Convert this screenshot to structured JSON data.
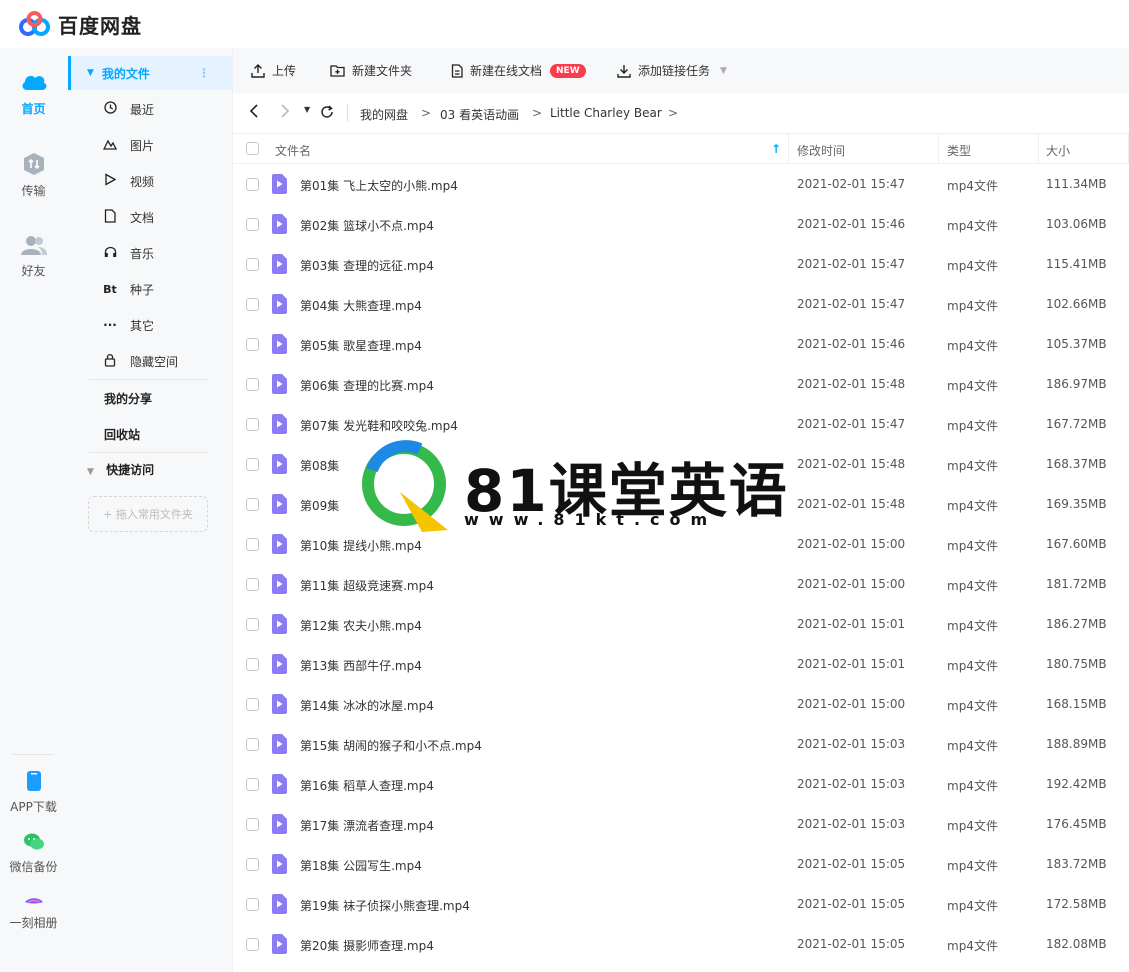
{
  "app": {
    "title": "百度网盘"
  },
  "rail": {
    "items": [
      {
        "label": "首页",
        "icon": "cloud-icon",
        "active": true
      },
      {
        "label": "传输",
        "icon": "transfer-icon"
      },
      {
        "label": "好友",
        "icon": "friends-icon"
      }
    ],
    "bottom": [
      {
        "label": "APP下载",
        "icon": "phone-icon"
      },
      {
        "label": "微信备份",
        "icon": "wechat-icon"
      },
      {
        "label": "一刻相册",
        "icon": "album-icon"
      }
    ]
  },
  "sidebar": {
    "header": "我的文件",
    "items": [
      {
        "label": "最近",
        "icon": "clock-icon"
      },
      {
        "label": "图片",
        "icon": "image-icon"
      },
      {
        "label": "视频",
        "icon": "video-icon"
      },
      {
        "label": "文档",
        "icon": "document-icon"
      },
      {
        "label": "音乐",
        "icon": "headphones-icon"
      },
      {
        "label": "种子",
        "icon": "bt-icon",
        "glyph": "Bt"
      },
      {
        "label": "其它",
        "icon": "more-icon"
      },
      {
        "label": "隐藏空间",
        "icon": "lock-icon"
      }
    ],
    "share": "我的分享",
    "recycle": "回收站",
    "quick_access": "快捷访问",
    "drop_hint": "+ 拖入常用文件夹"
  },
  "toolbar": {
    "upload": "上传",
    "new_folder": "新建文件夹",
    "new_doc": "新建在线文档",
    "new_badge": "NEW",
    "add_link": "添加链接任务"
  },
  "breadcrumb": {
    "segments": [
      "我的网盘",
      "03 看英语动画",
      "Little Charley Bear"
    ],
    "separator": ">"
  },
  "table": {
    "headers": {
      "name": "文件名",
      "modified": "修改时间",
      "type": "类型",
      "size": "大小"
    },
    "rows": [
      {
        "name": "第01集 飞上太空的小熊.mp4",
        "modified": "2021-02-01 15:47",
        "type": "mp4文件",
        "size": "111.34MB"
      },
      {
        "name": "第02集 篮球小不点.mp4",
        "modified": "2021-02-01 15:46",
        "type": "mp4文件",
        "size": "103.06MB"
      },
      {
        "name": "第03集 查理的远征.mp4",
        "modified": "2021-02-01 15:47",
        "type": "mp4文件",
        "size": "115.41MB"
      },
      {
        "name": "第04集 大熊查理.mp4",
        "modified": "2021-02-01 15:47",
        "type": "mp4文件",
        "size": "102.66MB"
      },
      {
        "name": "第05集 歌星查理.mp4",
        "modified": "2021-02-01 15:46",
        "type": "mp4文件",
        "size": "105.37MB"
      },
      {
        "name": "第06集 查理的比赛.mp4",
        "modified": "2021-02-01 15:48",
        "type": "mp4文件",
        "size": "186.97MB"
      },
      {
        "name": "第07集 发光鞋和咬咬兔.mp4",
        "modified": "2021-02-01 15:47",
        "type": "mp4文件",
        "size": "167.72MB"
      },
      {
        "name": "第08集",
        "modified": "2021-02-01 15:48",
        "type": "mp4文件",
        "size": "168.37MB"
      },
      {
        "name": "第09集",
        "modified": "2021-02-01 15:48",
        "type": "mp4文件",
        "size": "169.35MB"
      },
      {
        "name": "第10集 提线小熊.mp4",
        "modified": "2021-02-01 15:00",
        "type": "mp4文件",
        "size": "167.60MB"
      },
      {
        "name": "第11集 超级竞速赛.mp4",
        "modified": "2021-02-01 15:00",
        "type": "mp4文件",
        "size": "181.72MB"
      },
      {
        "name": "第12集 农夫小熊.mp4",
        "modified": "2021-02-01 15:01",
        "type": "mp4文件",
        "size": "186.27MB"
      },
      {
        "name": "第13集 西部牛仔.mp4",
        "modified": "2021-02-01 15:01",
        "type": "mp4文件",
        "size": "180.75MB"
      },
      {
        "name": "第14集 冰冰的冰屋.mp4",
        "modified": "2021-02-01 15:00",
        "type": "mp4文件",
        "size": "168.15MB"
      },
      {
        "name": "第15集 胡闹的猴子和小不点.mp4",
        "modified": "2021-02-01 15:03",
        "type": "mp4文件",
        "size": "188.89MB"
      },
      {
        "name": "第16集 稻草人查理.mp4",
        "modified": "2021-02-01 15:03",
        "type": "mp4文件",
        "size": "192.42MB"
      },
      {
        "name": "第17集 漂流者查理.mp4",
        "modified": "2021-02-01 15:03",
        "type": "mp4文件",
        "size": "176.45MB"
      },
      {
        "name": "第18集 公园写生.mp4",
        "modified": "2021-02-01 15:05",
        "type": "mp4文件",
        "size": "183.72MB"
      },
      {
        "name": "第19集 袜子侦探小熊查理.mp4",
        "modified": "2021-02-01 15:05",
        "type": "mp4文件",
        "size": "172.58MB"
      },
      {
        "name": "第20集 摄影师查理.mp4",
        "modified": "2021-02-01 15:05",
        "type": "mp4文件",
        "size": "182.08MB"
      }
    ]
  },
  "watermark": {
    "title": "81课堂英语",
    "url": "www.81kt.com"
  },
  "colors": {
    "accent": "#06a7ff",
    "file_icon": "#8b7cf6",
    "badge": "#fa3c4c"
  }
}
